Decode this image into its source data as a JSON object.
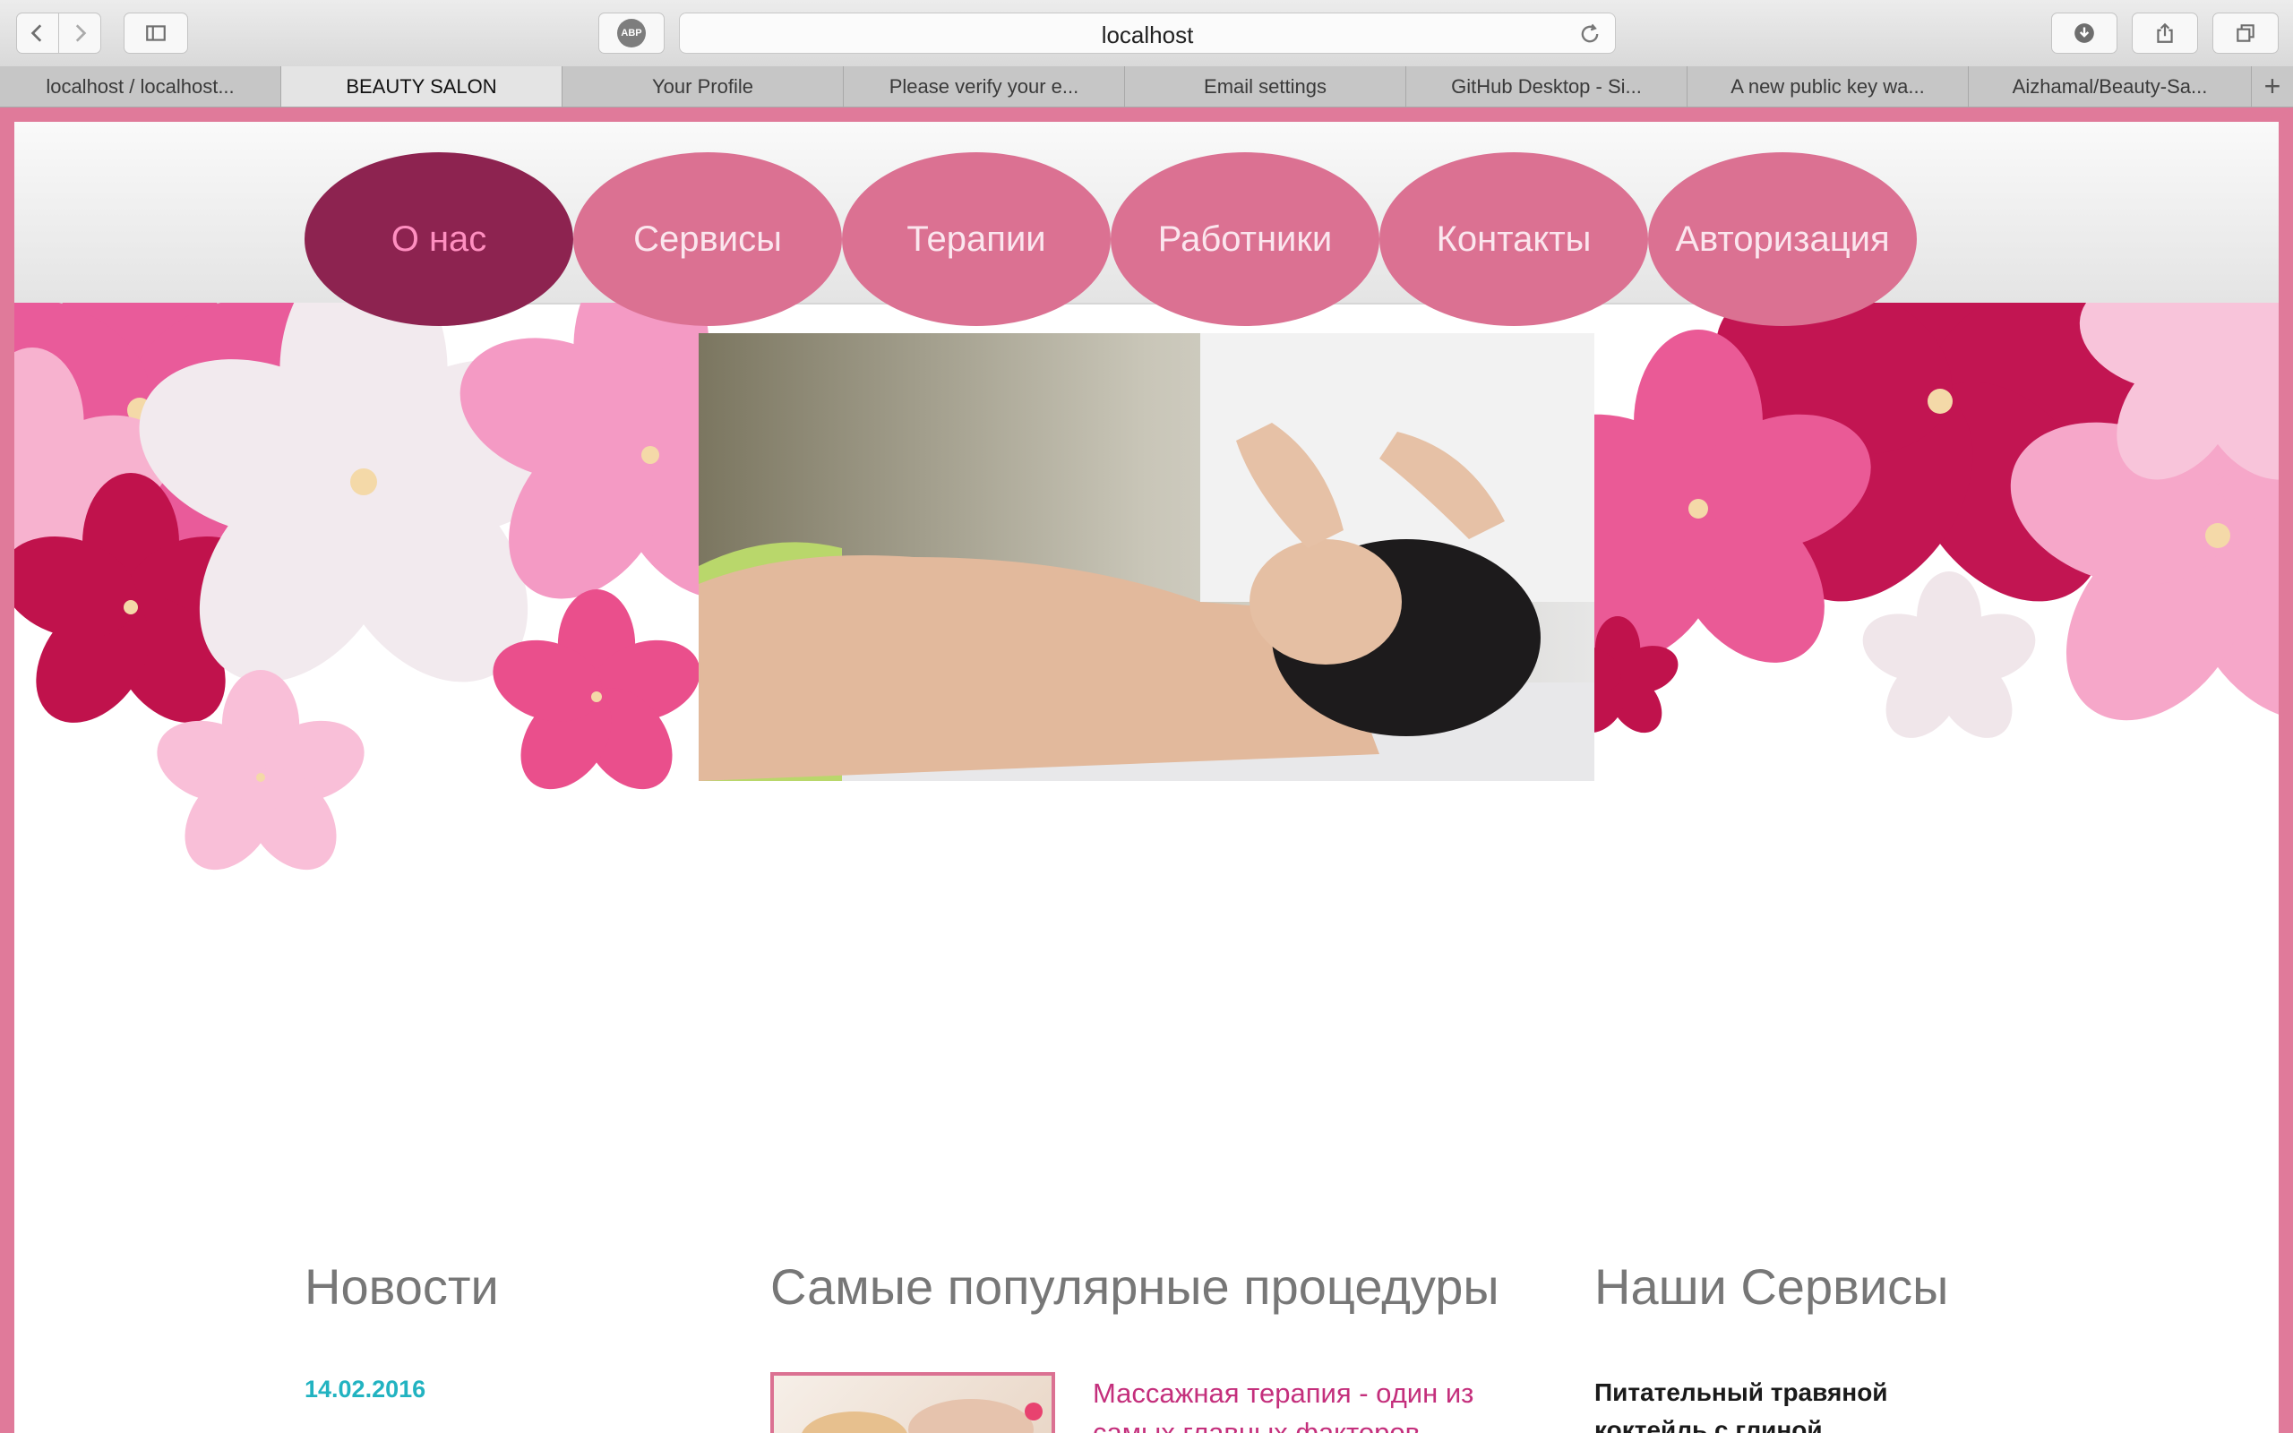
{
  "browser": {
    "url": "localhost",
    "adblock_label": "ABP",
    "tabs": [
      {
        "label": "localhost / localhost..."
      },
      {
        "label": "BEAUTY SALON"
      },
      {
        "label": "Your Profile"
      },
      {
        "label": "Please verify your e..."
      },
      {
        "label": "Email settings"
      },
      {
        "label": "GitHub Desktop - Si..."
      },
      {
        "label": "A new public key wa..."
      },
      {
        "label": "Aizhamal/Beauty-Sa..."
      }
    ],
    "active_tab": 1,
    "new_tab_label": "+"
  },
  "nav": {
    "items": [
      {
        "label": "О нас",
        "active": true
      },
      {
        "label": "Сервисы"
      },
      {
        "label": "Терапии"
      },
      {
        "label": "Работники"
      },
      {
        "label": "Контакты"
      },
      {
        "label": "Авторизация"
      }
    ]
  },
  "sections": {
    "news": {
      "title": "Новости",
      "date": "14.02.2016"
    },
    "popular": {
      "title": "Самые популярные процедуры",
      "item_text": "Массажная терапия - один из самых главных факторов"
    },
    "services": {
      "title": "Наши Сервисы",
      "item_text": "Питательный травяной коктейль с глиной"
    }
  },
  "colors": {
    "frame": "#e07a9a",
    "nav_button": "#db7192",
    "nav_active": "#8d2350",
    "date_accent": "#22b3c1",
    "link_pink": "#c42f7c"
  }
}
